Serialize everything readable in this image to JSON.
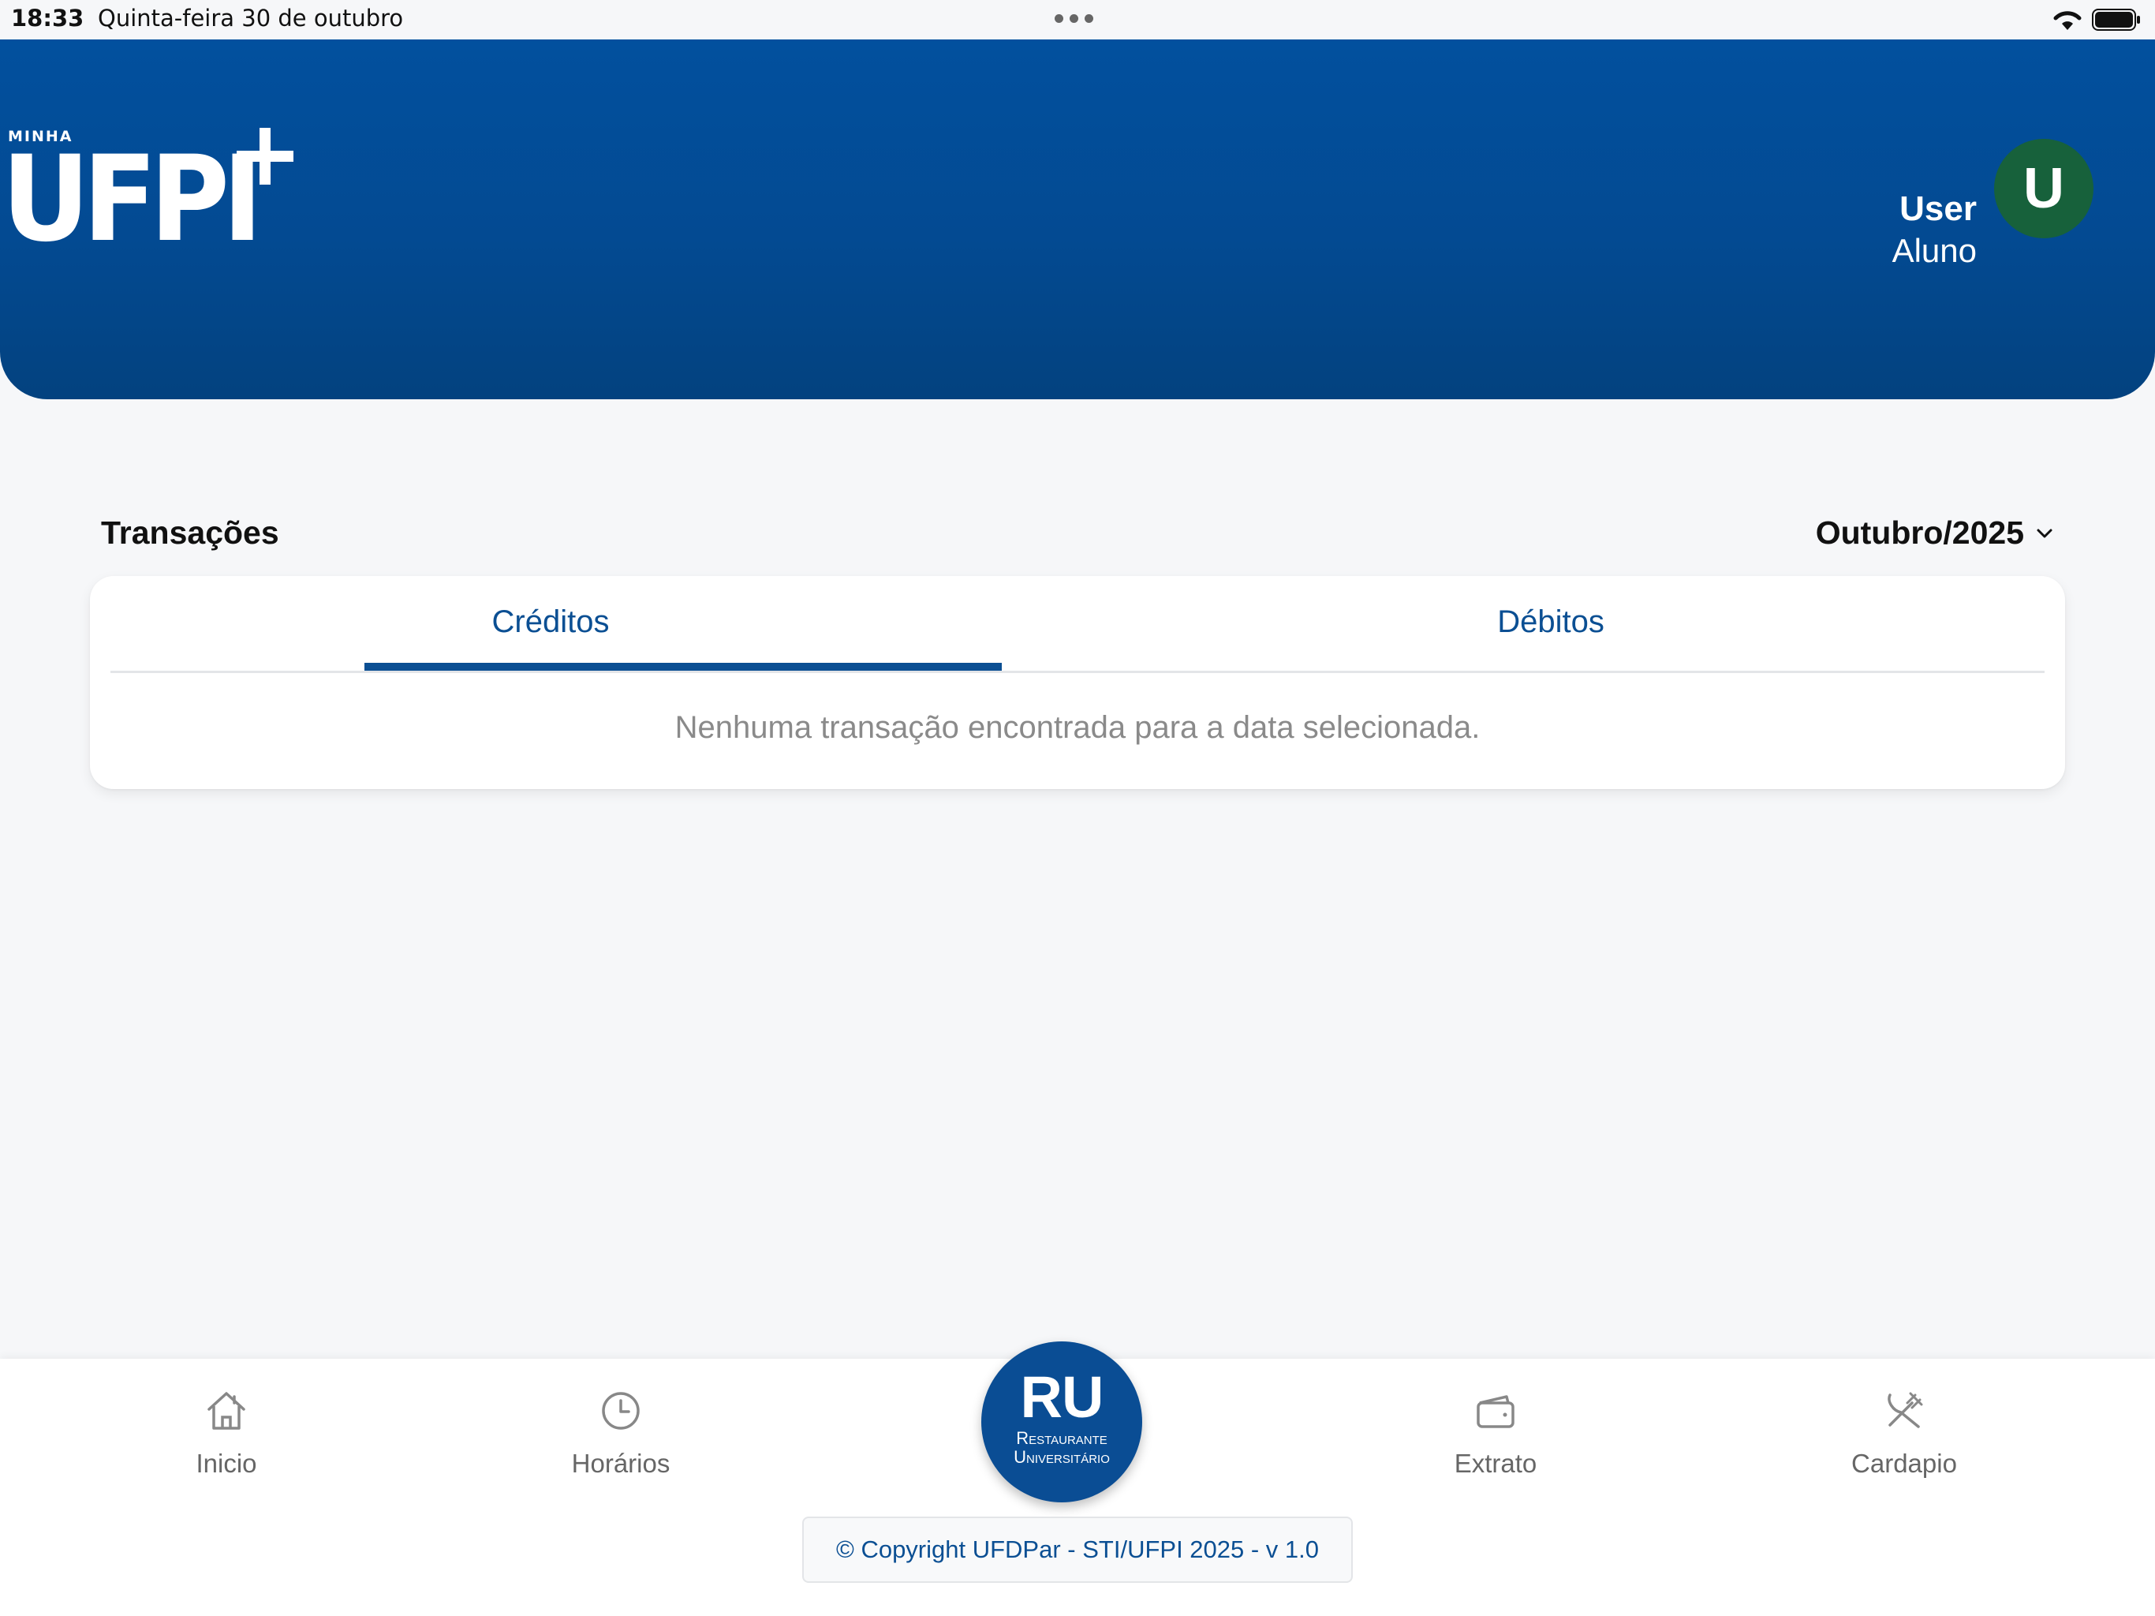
{
  "status_bar": {
    "time": "18:33",
    "date": "Quinta-feira 30 de outubro"
  },
  "header": {
    "logo_small": "MINHA",
    "logo_main": "UFPI",
    "user_name": "User",
    "user_role": "Aluno",
    "avatar_initial": "U"
  },
  "transactions": {
    "title": "Transações",
    "selected_month": "Outubro/2025",
    "tabs": [
      {
        "label": "Créditos",
        "active": true
      },
      {
        "label": "Débitos",
        "active": false
      }
    ],
    "empty_message": "Nenhuma transação encontrada para a data selecionada."
  },
  "bottom_nav": {
    "items": [
      {
        "label": "Inicio",
        "icon": "home-icon"
      },
      {
        "label": "Horários",
        "icon": "clock-icon"
      },
      {
        "label": "Extrato",
        "icon": "wallet-icon"
      },
      {
        "label": "Cardapio",
        "icon": "utensils-icon"
      }
    ],
    "ru_button": {
      "title": "RU",
      "line1": "Restaurante",
      "line2": "Universitário"
    }
  },
  "footer": {
    "copyright": "© Copyright UFDPar - STI/UFPI 2025 - v 1.0"
  },
  "colors": {
    "primary": "#0b4f93",
    "header_top": "#02509e",
    "avatar_bg": "#17613b",
    "background": "#f6f7f9"
  }
}
